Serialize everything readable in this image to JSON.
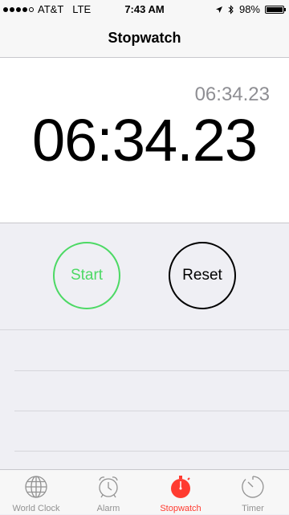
{
  "status_bar": {
    "carrier": "AT&T",
    "network": "LTE",
    "time": "7:43 AM",
    "battery": "98%",
    "battery_level": 0.98
  },
  "nav": {
    "title": "Stopwatch"
  },
  "stopwatch": {
    "lap_time": "06:34.23",
    "main_time": "06:34.23"
  },
  "buttons": {
    "start_label": "Start",
    "reset_label": "Reset"
  },
  "tabs": [
    {
      "label": "World Clock",
      "icon": "globe-icon"
    },
    {
      "label": "Alarm",
      "icon": "alarm-clock-icon"
    },
    {
      "label": "Stopwatch",
      "icon": "stopwatch-icon",
      "active": true
    },
    {
      "label": "Timer",
      "icon": "timer-icon"
    }
  ],
  "colors": {
    "start_green": "#4cd964",
    "active_red": "#ff3b30",
    "inactive_gray": "#929292"
  }
}
